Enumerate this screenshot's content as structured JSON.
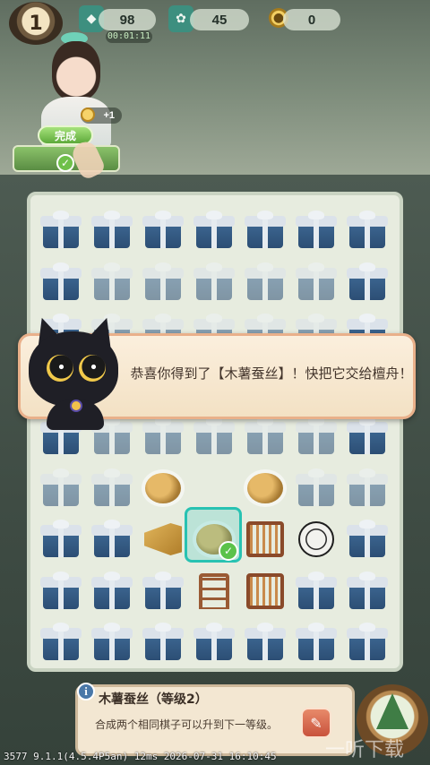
{
  "hud": {
    "level": "1",
    "resources": [
      {
        "name": "energy",
        "icon": "green-gem-icon",
        "value": "98"
      },
      {
        "name": "jade",
        "icon": "green-fish-icon",
        "value": "45"
      },
      {
        "name": "coins",
        "icon": "coin-icon",
        "value": "0"
      }
    ],
    "timer": "00:01:11"
  },
  "order": {
    "reward_text": "+1",
    "complete_label": "完成"
  },
  "board": {
    "rows": [
      [
        "gift",
        "gift",
        "gift",
        "gift",
        "gift",
        "gift",
        "gift"
      ],
      [
        "gift",
        "gift-faded",
        "gift-faded",
        "gift-faded",
        "gift-faded",
        "gift-faded",
        "gift"
      ],
      [
        "gift",
        "gift-faded",
        "gift-faded",
        "gift-faded",
        "gift-faded",
        "gift-faded",
        "gift"
      ],
      [
        "gift",
        "gift-faded",
        "gift-faded",
        "gift-faded",
        "gift-faded",
        "gift-faded",
        "gift"
      ],
      [
        "gift",
        "gift-faded",
        "gift-faded",
        "gift-faded",
        "gift-faded",
        "gift-faded",
        "gift"
      ],
      [
        "gift-faded",
        "gift-faded",
        "cocoon",
        "empty",
        "cocoon",
        "gift-faded",
        "gift-faded"
      ],
      [
        "gift",
        "gift",
        "horn",
        "cocoon",
        "loom",
        "fan",
        "gift"
      ],
      [
        "gift",
        "gift",
        "gift",
        "chair",
        "loom",
        "gift",
        "gift"
      ],
      [
        "gift",
        "gift",
        "gift",
        "gift",
        "gift",
        "gift",
        "gift"
      ]
    ]
  },
  "dialog": {
    "text": "恭喜你得到了【木薯蚕丝】！快把它交给檀舟！"
  },
  "info": {
    "title": "木薯蚕丝（等级2）",
    "description": "合成两个相同棋子可以升到下一等级。"
  },
  "debug": "3577 9.1.1(4.5.4P5an) 12ms 2026-07-31 16:10:45",
  "watermark": "一听下载"
}
